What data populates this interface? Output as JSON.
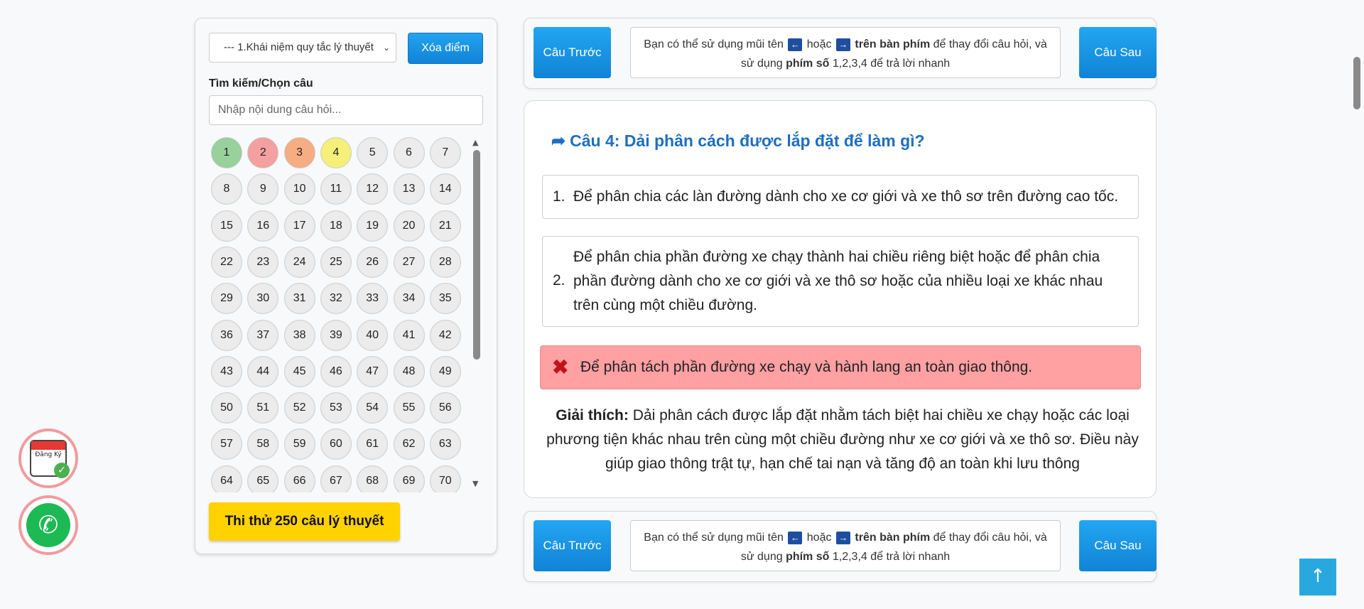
{
  "sidebar": {
    "topic_select_value": "--- 1.Khái niệm quy tắc lý thuyết",
    "clear_label": "Xóa điểm",
    "search_label": "Tìm kiếm/Chọn câu",
    "search_placeholder": "Nhập nội dung câu hỏi...",
    "questions": [
      "1",
      "2",
      "3",
      "4",
      "5",
      "6",
      "7",
      "8",
      "9",
      "10",
      "11",
      "12",
      "13",
      "14",
      "15",
      "16",
      "17",
      "18",
      "19",
      "20",
      "21",
      "22",
      "23",
      "24",
      "25",
      "26",
      "27",
      "28",
      "29",
      "30",
      "31",
      "32",
      "33",
      "34",
      "35",
      "36",
      "37",
      "38",
      "39",
      "40",
      "41",
      "42",
      "43",
      "44",
      "45",
      "46",
      "47",
      "48",
      "49",
      "50",
      "51",
      "52",
      "53",
      "54",
      "55",
      "56",
      "57",
      "58",
      "59",
      "60",
      "61",
      "62",
      "63",
      "64",
      "65",
      "66",
      "67",
      "68",
      "69",
      "70"
    ],
    "question_states": {
      "1": "#98d19c",
      "2": "#f5a0a0",
      "3": "#f7ad82",
      "4": "#f5f07a"
    },
    "exam_label": "Thi thử 250 câu lý thuyết"
  },
  "nav": {
    "prev_label": "Câu Trước",
    "next_label": "Câu Sau",
    "hint_a": "Bạn có thể sử dụng mũi tên",
    "hint_or": "hoặc",
    "hint_keyboard": "trên bàn phím",
    "hint_b": "để thay đổi câu hỏi, và",
    "hint_c": "sử dụng",
    "hint_numkeys": "phím số",
    "hint_d": "1,2,3,4 để trả lời nhanh"
  },
  "question": {
    "title": "Câu 4: Dải phân cách được lắp đặt để làm gì?",
    "answers": [
      {
        "num": "1.",
        "text": "Để phân chia các làn đường dành cho xe cơ giới và xe thô sơ trên đường cao tốc."
      },
      {
        "num": "2.",
        "text": "Để phân chia phần đường xe chạy thành hai chiều riêng biệt hoặc để phân chia phần đường dành cho xe cơ giới và xe thô sơ hoặc của nhiều loại xe khác nhau trên cùng một chiều đường."
      },
      {
        "num": "",
        "text": "Để phân tách phần đường xe chạy và hành lang an toàn giao thông."
      }
    ],
    "explanation_label": "Giải thích:",
    "explanation_text": "Dải phân cách được lắp đặt nhằm tách biệt hai chiều xe chạy hoặc các loại phương tiện khác nhau trên cùng một chiều đường như xe cơ giới và xe thô sơ. Điều này giúp giao thông trật tự, hạn chế tai nạn và tăng độ an toàn khi lưu thông"
  },
  "floating": {
    "register_label": "Đăng Ký"
  },
  "colors": {
    "accent": "#1a8ee3",
    "wrong_answer_bg": "#ffa0a3",
    "exam_button": "#ffd200"
  }
}
